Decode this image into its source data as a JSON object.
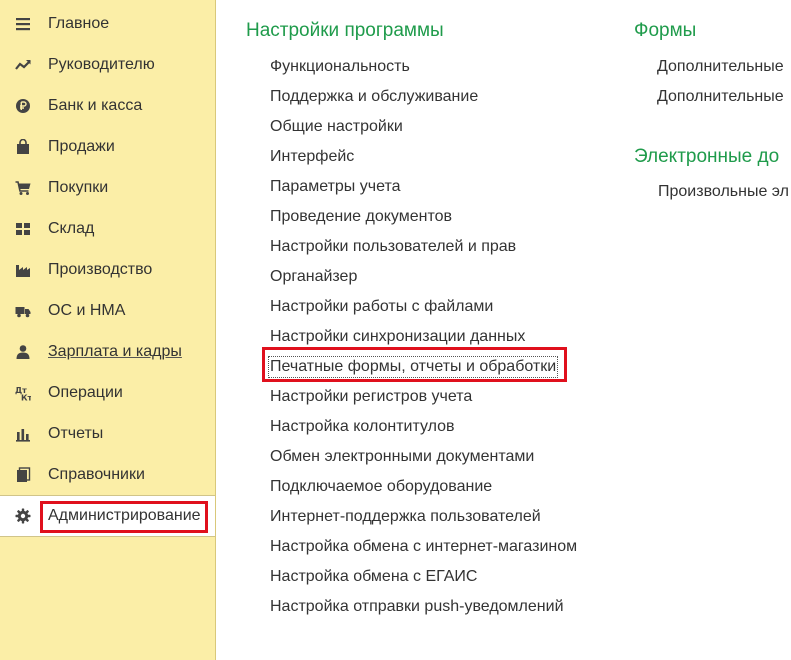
{
  "sidebar": {
    "items": [
      {
        "label": "Главное",
        "icon": "menu-lines-icon"
      },
      {
        "label": "Руководителю",
        "icon": "trend-line-icon"
      },
      {
        "label": "Банк и касса",
        "icon": "ruble-coin-icon"
      },
      {
        "label": "Продажи",
        "icon": "shopping-bag-icon"
      },
      {
        "label": "Покупки",
        "icon": "cart-icon"
      },
      {
        "label": "Склад",
        "icon": "warehouse-grid-icon"
      },
      {
        "label": "Производство",
        "icon": "factory-icon"
      },
      {
        "label": "ОС и НМА",
        "icon": "truck-icon"
      },
      {
        "label": "Зарплата и кадры",
        "icon": "person-icon"
      },
      {
        "label": "Операции",
        "icon": "dt-kt-icon"
      },
      {
        "label": "Отчеты",
        "icon": "bar-chart-icon"
      },
      {
        "label": "Справочники",
        "icon": "books-icon"
      },
      {
        "label": "Администрирование",
        "icon": "gear-icon"
      }
    ]
  },
  "main": {
    "settings": {
      "title": "Настройки программы",
      "links": [
        "Функциональность",
        "Поддержка и обслуживание",
        "Общие настройки",
        "Интерфейс",
        "Параметры учета",
        "Проведение документов",
        "Настройки пользователей и прав",
        "Органайзер",
        "Настройки работы с файлами",
        "Настройки синхронизации данных",
        "Печатные формы, отчеты и обработки",
        "Настройки регистров учета",
        "Настройка колонтитулов",
        "Обмен электронными документами",
        "Подключаемое оборудование",
        "Интернет-поддержка пользователей",
        "Настройка обмена с интернет-магазином",
        "Настройка обмена с ЕГАИС",
        "Настройка отправки push-уведомлений"
      ]
    },
    "forms": {
      "title": "Формы",
      "links": [
        "Дополнительные",
        "Дополнительные"
      ]
    },
    "edocs": {
      "title": "Электронные до",
      "links": [
        "Произвольные эл"
      ]
    }
  },
  "colors": {
    "sidebar_bg": "#fbeea7",
    "section_title": "#1f9b4b",
    "highlight": "#e0101d"
  }
}
